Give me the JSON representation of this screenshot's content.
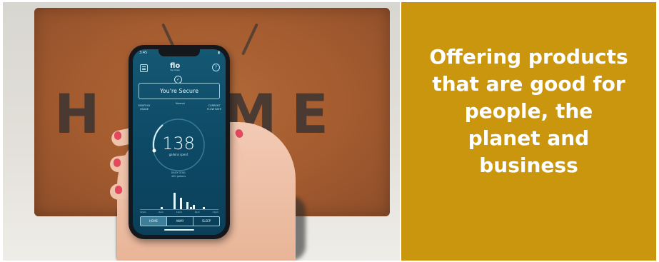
{
  "photo": {
    "doormat_letters": [
      "H",
      "M",
      "E"
    ],
    "phone": {
      "status_time": "3:45",
      "logo": "flo",
      "logo_sub": "by moen",
      "status_message": "You're Secure",
      "left_stat": "MONTHLY USAGE",
      "center_stat": "Normal",
      "right_stat": "CURRENT FLOW RATE",
      "gallons_value": "138",
      "gallons_label": "gallons spent",
      "daily_goal_label": "DAILY GOAL",
      "daily_goal_value": "400 gallons",
      "bar_values": [
        0,
        0,
        0,
        0,
        0,
        0,
        2,
        0,
        0,
        0,
        14,
        0,
        10,
        0,
        6,
        2,
        4,
        0,
        0,
        2,
        0,
        0,
        0,
        0
      ],
      "times": [
        "12am",
        "6am",
        "12pm",
        "6pm",
        "11pm"
      ],
      "modes": [
        "HOME",
        "AWAY",
        "SLEEP"
      ],
      "active_mode": "HOME"
    }
  },
  "panel": {
    "background_color": "#c9960d",
    "headline_lines": [
      "Offering products",
      "that are good for",
      "people, the",
      "planet and",
      "business"
    ]
  }
}
